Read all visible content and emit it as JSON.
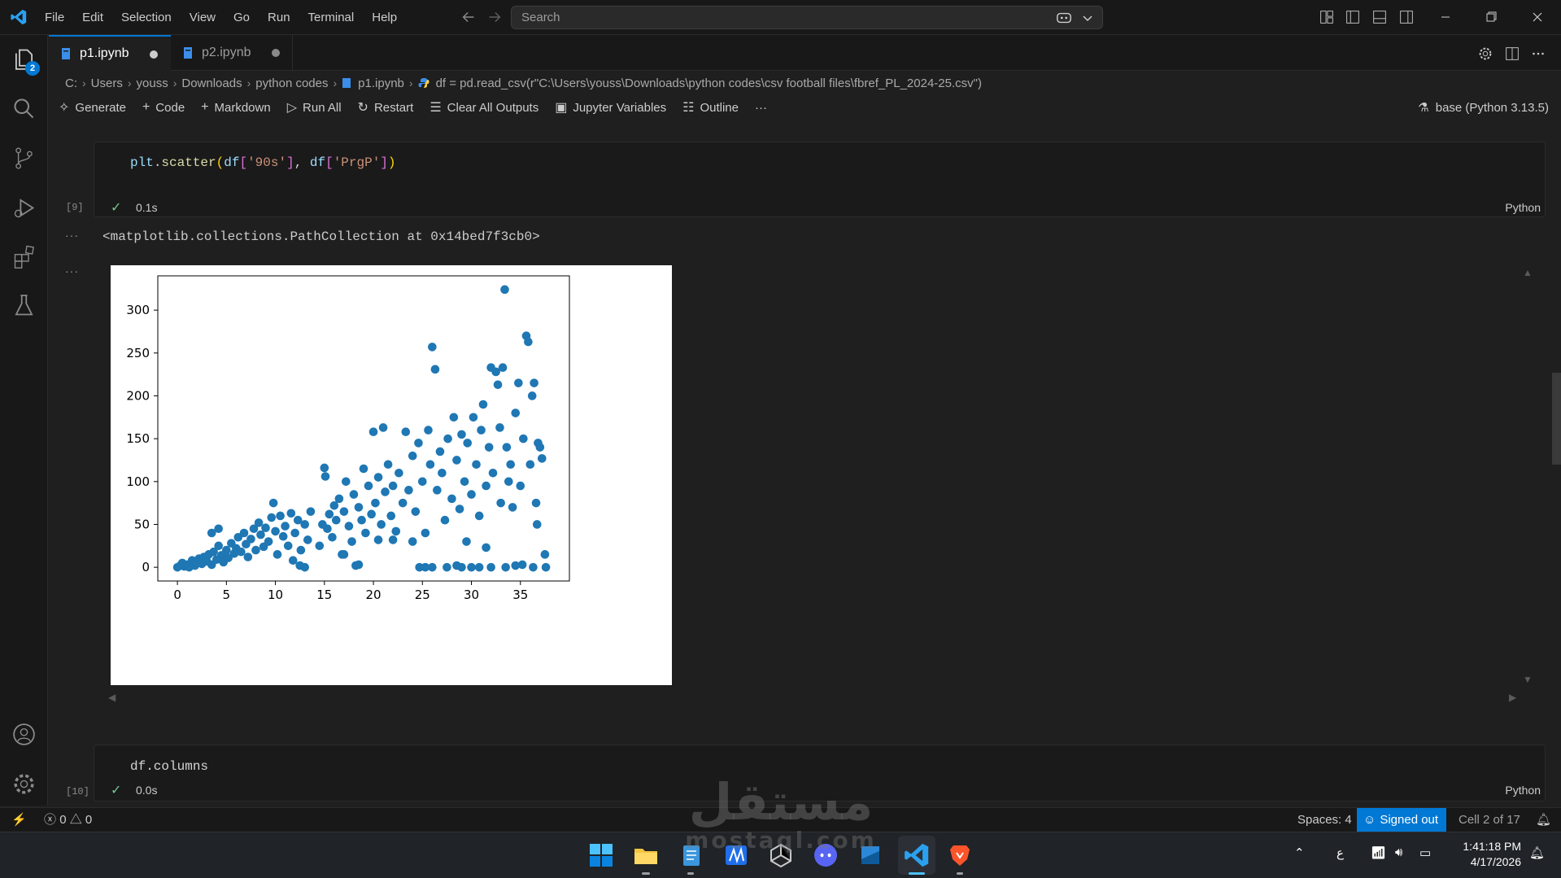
{
  "window": {
    "menu": [
      "File",
      "Edit",
      "Selection",
      "View",
      "Go",
      "Run",
      "Terminal",
      "Help"
    ],
    "search_placeholder": "Search"
  },
  "activity": {
    "explorer_badge": "2"
  },
  "tabs": [
    {
      "label": "p1.ipynb",
      "active": true,
      "dirty": true
    },
    {
      "label": "p2.ipynb",
      "active": false,
      "dirty": true
    }
  ],
  "breadcrumb": {
    "drive": "C:",
    "parts": [
      "Users",
      "youss",
      "Downloads",
      "python codes"
    ],
    "file": "p1.ipynb",
    "symbol": "df = pd.read_csv(r\"C:\\Users\\youss\\Downloads\\python codes\\csv football files\\fbref_PL_2024-25.csv\")"
  },
  "toolbar": {
    "generate": "Generate",
    "code": "Code",
    "markdown": "Markdown",
    "run_all": "Run All",
    "restart": "Restart",
    "clear_outputs": "Clear All Outputs",
    "variables": "Jupyter Variables",
    "outline": "Outline",
    "more": "···",
    "kernel": "base (Python 3.13.5)"
  },
  "cells": [
    {
      "exec": "[9]",
      "time": "0.1s",
      "lang": "Python",
      "code": {
        "fn": "plt",
        "method": "scatter",
        "arg1": "'90s'",
        "arg2": "'PrgP'"
      }
    },
    {
      "exec": "[10]",
      "time": "0.0s",
      "lang": "Python",
      "code_text": "df.columns"
    }
  ],
  "output": {
    "ellipsis": "···",
    "repr": "<matplotlib.collections.PathCollection at 0x14bed7f3cb0>"
  },
  "chart_data": {
    "type": "scatter",
    "title": "",
    "xlabel": "",
    "ylabel": "",
    "xlim": [
      -2,
      40
    ],
    "ylim": [
      -16,
      340
    ],
    "xticks": [
      0,
      5,
      10,
      15,
      20,
      25,
      30,
      35
    ],
    "yticks": [
      0,
      50,
      100,
      150,
      200,
      250,
      300
    ],
    "grid": false,
    "color": "#1f77b4",
    "points": [
      [
        0,
        0
      ],
      [
        0.3,
        2
      ],
      [
        0.5,
        5
      ],
      [
        0.7,
        1
      ],
      [
        1,
        3
      ],
      [
        1.2,
        0
      ],
      [
        1.5,
        8
      ],
      [
        1.8,
        2
      ],
      [
        2,
        6
      ],
      [
        2.2,
        10
      ],
      [
        2.5,
        4
      ],
      [
        2.7,
        12
      ],
      [
        3,
        7
      ],
      [
        3.2,
        15
      ],
      [
        3.5,
        3
      ],
      [
        3.7,
        18
      ],
      [
        4,
        9
      ],
      [
        4.2,
        25
      ],
      [
        4.5,
        14
      ],
      [
        4.7,
        6
      ],
      [
        5,
        20
      ],
      [
        5.2,
        11
      ],
      [
        5.5,
        28
      ],
      [
        5.8,
        16
      ],
      [
        6,
        22
      ],
      [
        6.2,
        35
      ],
      [
        6.5,
        18
      ],
      [
        6.8,
        40
      ],
      [
        7,
        27
      ],
      [
        7.2,
        12
      ],
      [
        7.5,
        33
      ],
      [
        7.8,
        45
      ],
      [
        8,
        20
      ],
      [
        8.3,
        52
      ],
      [
        8.5,
        38
      ],
      [
        8.8,
        24
      ],
      [
        9,
        46
      ],
      [
        9.3,
        30
      ],
      [
        9.6,
        58
      ],
      [
        10,
        42
      ],
      [
        10.2,
        15
      ],
      [
        10.5,
        60
      ],
      [
        10.8,
        36
      ],
      [
        11,
        48
      ],
      [
        11.3,
        25
      ],
      [
        11.6,
        63
      ],
      [
        12,
        40
      ],
      [
        12.3,
        55
      ],
      [
        12.6,
        20
      ],
      [
        13,
        50
      ],
      [
        13.3,
        32
      ],
      [
        13.6,
        65
      ],
      [
        3.5,
        40
      ],
      [
        4.2,
        45
      ],
      [
        9.8,
        75
      ],
      [
        11.8,
        8
      ],
      [
        12.5,
        2
      ],
      [
        13,
        0
      ],
      [
        14.5,
        25
      ],
      [
        14.8,
        50
      ],
      [
        15,
        116
      ],
      [
        15.1,
        106
      ],
      [
        15.3,
        45
      ],
      [
        15.5,
        62
      ],
      [
        15.8,
        35
      ],
      [
        16,
        72
      ],
      [
        16.2,
        55
      ],
      [
        16.5,
        80
      ],
      [
        16.8,
        15
      ],
      [
        17,
        65
      ],
      [
        17.2,
        100
      ],
      [
        17.5,
        48
      ],
      [
        17.8,
        30
      ],
      [
        18,
        85
      ],
      [
        18.2,
        2
      ],
      [
        18.5,
        70
      ],
      [
        18.8,
        55
      ],
      [
        19,
        115
      ],
      [
        19.2,
        40
      ],
      [
        19.5,
        95
      ],
      [
        19.8,
        62
      ],
      [
        20,
        158
      ],
      [
        20.2,
        75
      ],
      [
        20.5,
        105
      ],
      [
        20.8,
        50
      ],
      [
        21,
        163
      ],
      [
        21.2,
        88
      ],
      [
        21.5,
        120
      ],
      [
        21.8,
        60
      ],
      [
        22,
        95
      ],
      [
        22.3,
        42
      ],
      [
        22.6,
        110
      ],
      [
        23,
        75
      ],
      [
        23.3,
        158
      ],
      [
        23.6,
        90
      ],
      [
        24,
        130
      ],
      [
        24.3,
        65
      ],
      [
        24.6,
        145
      ],
      [
        25,
        100
      ],
      [
        25.3,
        40
      ],
      [
        25.6,
        160
      ],
      [
        25.8,
        120
      ],
      [
        26,
        257
      ],
      [
        26.3,
        231
      ],
      [
        26.5,
        90
      ],
      [
        26.8,
        135
      ],
      [
        27,
        110
      ],
      [
        27.3,
        55
      ],
      [
        27.6,
        150
      ],
      [
        28,
        80
      ],
      [
        28.2,
        175
      ],
      [
        28.5,
        125
      ],
      [
        28.8,
        68
      ],
      [
        29,
        155
      ],
      [
        29.3,
        100
      ],
      [
        29.6,
        145
      ],
      [
        30,
        85
      ],
      [
        30.2,
        175
      ],
      [
        30.5,
        120
      ],
      [
        30.8,
        60
      ],
      [
        31,
        160
      ],
      [
        31.2,
        190
      ],
      [
        31.5,
        95
      ],
      [
        31.8,
        140
      ],
      [
        32,
        233
      ],
      [
        32.2,
        110
      ],
      [
        32.5,
        228
      ],
      [
        32.7,
        213
      ],
      [
        32.9,
        163
      ],
      [
        33,
        75
      ],
      [
        33.2,
        233
      ],
      [
        33.4,
        324
      ],
      [
        33.6,
        140
      ],
      [
        33.8,
        100
      ],
      [
        34,
        120
      ],
      [
        34.2,
        70
      ],
      [
        34.5,
        180
      ],
      [
        34.8,
        215
      ],
      [
        35,
        95
      ],
      [
        35.3,
        150
      ],
      [
        35.6,
        270
      ],
      [
        35.8,
        263
      ],
      [
        36,
        120
      ],
      [
        36.2,
        200
      ],
      [
        36.4,
        215
      ],
      [
        36.6,
        75
      ],
      [
        36.8,
        145
      ],
      [
        37,
        140
      ],
      [
        37.2,
        127
      ],
      [
        37.5,
        15
      ],
      [
        37.6,
        0
      ],
      [
        36.7,
        50
      ],
      [
        36.3,
        0
      ],
      [
        35.2,
        3
      ],
      [
        34.5,
        2
      ],
      [
        33.5,
        0
      ],
      [
        32,
        0
      ],
      [
        31.5,
        23
      ],
      [
        30.8,
        0
      ],
      [
        30,
        0
      ],
      [
        29.5,
        30
      ],
      [
        29,
        0
      ],
      [
        28.5,
        2
      ],
      [
        27.5,
        0
      ],
      [
        26,
        0
      ],
      [
        25.3,
        0
      ],
      [
        24.7,
        0
      ],
      [
        24,
        30
      ],
      [
        22,
        32
      ],
      [
        20.5,
        32
      ],
      [
        18.5,
        3
      ],
      [
        17,
        15
      ]
    ]
  },
  "statusbar": {
    "errors": "0",
    "warnings": "0",
    "spaces": "Spaces: 4",
    "signed_out": "Signed out",
    "cell_pos": "Cell 2 of 17"
  },
  "taskbar": {
    "ime": "ع",
    "time": "1:41:18 PM",
    "date": "4/17/2026"
  },
  "watermark": {
    "text": "مستقل",
    "sub": "mostaql.com"
  }
}
